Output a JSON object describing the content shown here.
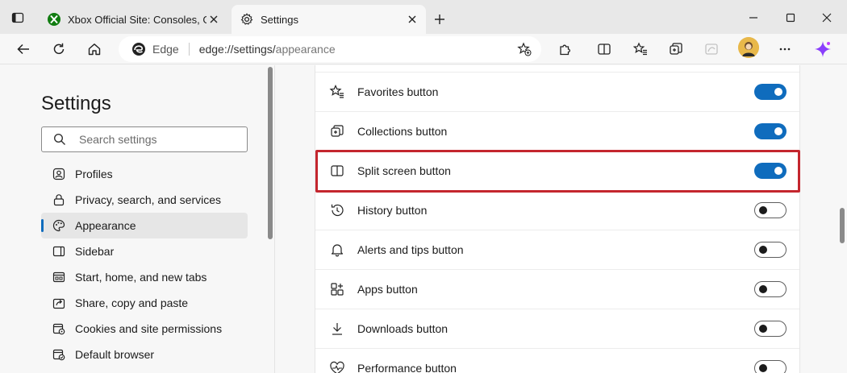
{
  "tabs": [
    {
      "title": "Xbox Official Site: Consoles, Gam",
      "active": false
    },
    {
      "title": "Settings",
      "active": true
    }
  ],
  "address": {
    "brand": "Edge",
    "url_scheme": "edge://settings/",
    "url_path": "appearance"
  },
  "sidebar": {
    "heading": "Settings",
    "search_placeholder": "Search settings",
    "items": [
      {
        "label": "Profiles",
        "icon": "profile-icon",
        "selected": false
      },
      {
        "label": "Privacy, search, and services",
        "icon": "lock-icon",
        "selected": false
      },
      {
        "label": "Appearance",
        "icon": "palette-icon",
        "selected": true
      },
      {
        "label": "Sidebar",
        "icon": "sidebar-icon",
        "selected": false
      },
      {
        "label": "Start, home, and new tabs",
        "icon": "home-tabs-icon",
        "selected": false
      },
      {
        "label": "Share, copy and paste",
        "icon": "share-icon",
        "selected": false
      },
      {
        "label": "Cookies and site permissions",
        "icon": "cookies-icon",
        "selected": false
      },
      {
        "label": "Default browser",
        "icon": "browser-icon",
        "selected": false
      }
    ]
  },
  "settings_rows": [
    {
      "label": "Favorites button",
      "icon": "favorites-icon",
      "enabled": true
    },
    {
      "label": "Collections button",
      "icon": "collections-icon",
      "enabled": true
    },
    {
      "label": "Split screen button",
      "icon": "split-screen-icon",
      "enabled": true
    },
    {
      "label": "History button",
      "icon": "history-icon",
      "enabled": false
    },
    {
      "label": "Alerts and tips button",
      "icon": "bell-icon",
      "enabled": false
    },
    {
      "label": "Apps button",
      "icon": "apps-icon",
      "enabled": false
    },
    {
      "label": "Downloads button",
      "icon": "download-icon",
      "enabled": false
    },
    {
      "label": "Performance button",
      "icon": "performance-icon",
      "enabled": false
    }
  ],
  "colors": {
    "accent": "#0f6cbd",
    "highlight": "#c4262e",
    "copilot": "#8a3ffc"
  }
}
